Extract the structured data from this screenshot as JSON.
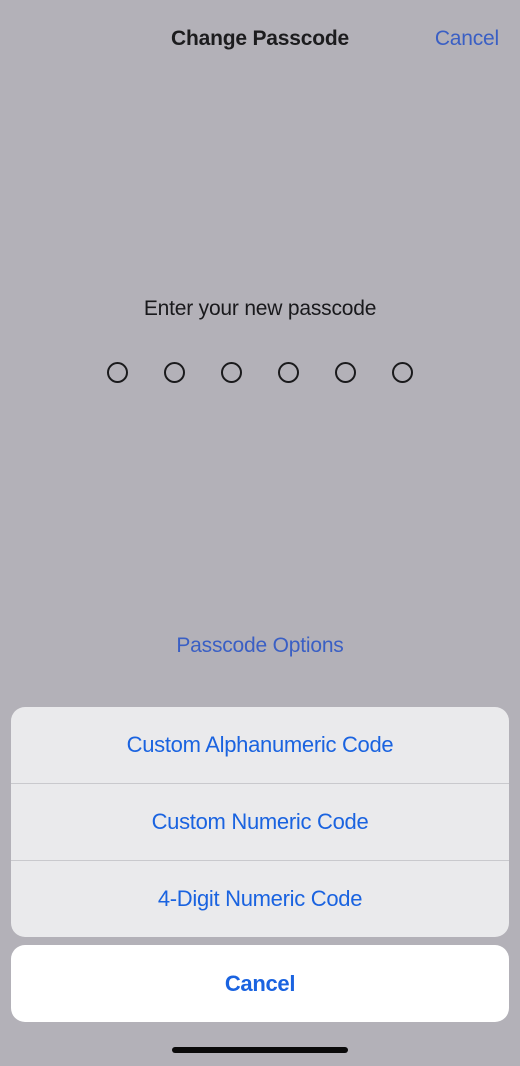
{
  "theme": {
    "background": "#b3b1b8",
    "sheet_background": "#eaeaec",
    "cancel_background": "#ffffff",
    "accent_blue": "#1a63e0",
    "dimmed_blue": "#3a5fc4",
    "text_dark": "#1c1c1e",
    "separator": "#c9c9cd",
    "home_indicator": "#0a0a0a"
  },
  "nav": {
    "title": "Change Passcode",
    "cancel_label": "Cancel"
  },
  "passcode": {
    "prompt": "Enter your new passcode",
    "digit_count": 6,
    "entered_count": 0,
    "dots": [
      {
        "filled": false
      },
      {
        "filled": false
      },
      {
        "filled": false
      },
      {
        "filled": false
      },
      {
        "filled": false
      },
      {
        "filled": false
      }
    ],
    "options_link_label": "Passcode Options"
  },
  "action_sheet": {
    "visible": true,
    "items": [
      {
        "label": "Custom Alphanumeric Code"
      },
      {
        "label": "Custom Numeric Code"
      },
      {
        "label": "4-Digit Numeric Code"
      }
    ],
    "cancel_label": "Cancel"
  }
}
